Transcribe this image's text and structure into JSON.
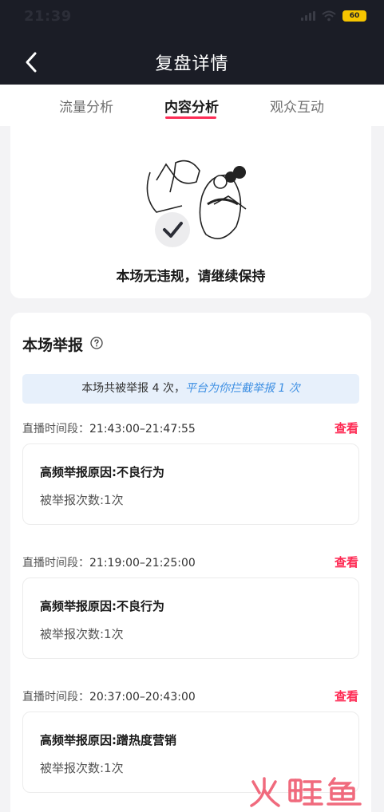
{
  "status_bar": {
    "time": "21:39",
    "battery": "60"
  },
  "header": {
    "title": "复盘详情"
  },
  "tabs": [
    {
      "label": "流量分析",
      "active": false
    },
    {
      "label": "内容分析",
      "active": true
    },
    {
      "label": "观众互动",
      "active": false
    }
  ],
  "content_card": {
    "message": "本场无违规，请继续保持"
  },
  "reports": {
    "title": "本场举报",
    "summary_prefix": "本场共被举报 4 次，",
    "summary_highlight": "平台为你拦截举报 1 次",
    "period_label": "直播时间段：",
    "view_label": "查看",
    "items": [
      {
        "period": "21:43:00–21:47:55",
        "reason": "高频举报原因:不良行为",
        "count": "被举报次数:1次"
      },
      {
        "period": "21:19:00–21:25:00",
        "reason": "高频举报原因:不良行为",
        "count": "被举报次数:1次"
      },
      {
        "period": "20:37:00–20:43:00",
        "reason": "高频举报原因:蹭热度营销",
        "count": "被举报次数:1次"
      }
    ]
  },
  "colors": {
    "accent": "#fe2c55",
    "highlight": "#3d8fe3",
    "header_bg": "#1b1d26",
    "summary_bg": "#e7f0fb"
  },
  "watermark": {
    "text": "火鲤鱼"
  }
}
